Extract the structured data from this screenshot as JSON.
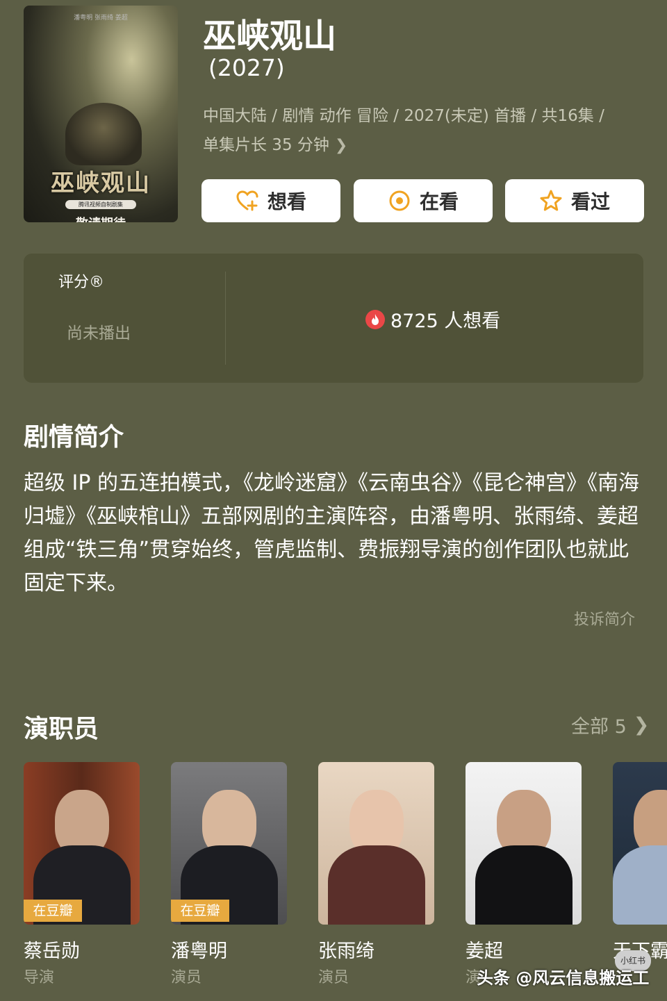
{
  "poster": {
    "credits": "潘粤明 张雨绮 姜超",
    "title": "巫峡观山",
    "badge": "腾讯视频自制剧集",
    "subtitle": "敬请期待"
  },
  "header": {
    "title": "巫峡观山",
    "year": "(2027)",
    "meta_line1": "中国大陆 / 剧情 动作 冒险 / 2027(未定) 首播 / 共16集 /",
    "meta_line2": "单集片长 35 分钟"
  },
  "actions": {
    "want": "想看",
    "watching": "在看",
    "watched": "看过"
  },
  "rating": {
    "label": "评分®",
    "status": "尚未播出",
    "want_count": "8725 人想看"
  },
  "synopsis": {
    "title": "剧情简介",
    "body": "超级 IP 的五连拍模式，《龙岭迷窟》《云南虫谷》《昆仑神宫》《南海归墟》《巫峡棺山》五部网剧的主演阵容，由潘粤明、张雨绮、姜超 组成“铁三角”贯穿始终，管虎监制、费振翔导演的创作团队也就此固定下来。",
    "report": "投诉简介"
  },
  "cast": {
    "title": "演职员",
    "all_label": "全部 5",
    "tag": "在豆瓣",
    "members": [
      {
        "name": "蔡岳勋",
        "role": "导演",
        "tagged": true
      },
      {
        "name": "潘粤明",
        "role": "演员",
        "tagged": true
      },
      {
        "name": "张雨绮",
        "role": "演员",
        "tagged": false
      },
      {
        "name": "姜超",
        "role": "演",
        "tagged": false
      },
      {
        "name": "天下霸",
        "role": "",
        "tagged": false
      }
    ]
  },
  "watermark": {
    "text": "头条 @风云信息搬运工",
    "badge": "小红书"
  },
  "colors": {
    "background": "#5c5e45",
    "panel": "#505238",
    "button_bg": "#ffffff",
    "accent_orange": "#f0a321",
    "tag_orange": "#e7a93f",
    "flame_red": "#ea4747"
  }
}
